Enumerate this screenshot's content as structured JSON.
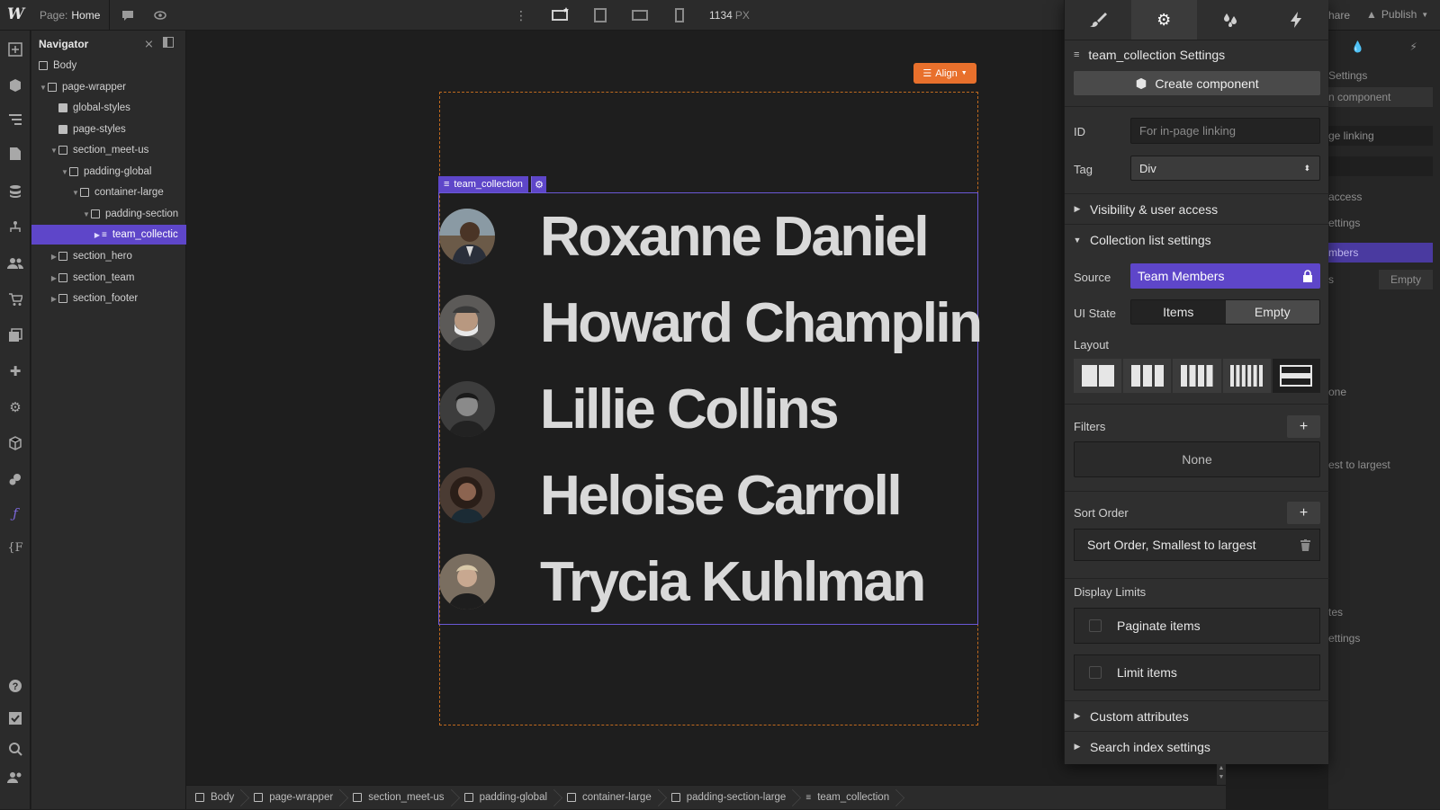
{
  "topbar": {
    "logo": "W",
    "page_prefix": "Page:",
    "page_name": "Home",
    "width_value": "1134",
    "width_unit": "PX",
    "share_label": "hare",
    "publish_label": "Publish"
  },
  "navigator": {
    "title": "Navigator",
    "items": [
      {
        "label": "Body"
      },
      {
        "label": "page-wrapper"
      },
      {
        "label": "global-styles"
      },
      {
        "label": "page-styles"
      },
      {
        "label": "section_meet-us"
      },
      {
        "label": "padding-global"
      },
      {
        "label": "container-large"
      },
      {
        "label": "padding-section"
      },
      {
        "label": "team_collectic"
      },
      {
        "label": "section_hero"
      },
      {
        "label": "section_team"
      },
      {
        "label": "section_footer"
      }
    ]
  },
  "canvas": {
    "align_label": "Align",
    "collection_tag": "team_collection",
    "members": [
      {
        "name": "Roxanne Daniel",
        "avatar_color": "#6b5a48"
      },
      {
        "name": "Howard Champlin",
        "avatar_color": "#5c5a58"
      },
      {
        "name": "Lillie Collins",
        "avatar_color": "#3d3d3d"
      },
      {
        "name": "Heloise Carroll",
        "avatar_color": "#4a3b33"
      },
      {
        "name": "Trycia Kuhlman",
        "avatar_color": "#7a6e60"
      }
    ]
  },
  "panel": {
    "header_title": "team_collection Settings",
    "create_component_label": "Create component",
    "id_label": "ID",
    "id_placeholder": "For in-page linking",
    "tag_label": "Tag",
    "tag_value": "Div",
    "visibility_label": "Visibility & user access",
    "collection_settings_label": "Collection list settings",
    "source_label": "Source",
    "source_value": "Team Members",
    "ui_state_label": "UI State",
    "ui_state_items": "Items",
    "ui_state_empty": "Empty",
    "layout_label": "Layout",
    "filters_label": "Filters",
    "filters_value": "None",
    "sort_order_label": "Sort Order",
    "sort_order_value": "Sort Order, Smallest to largest",
    "display_limits_label": "Display Limits",
    "paginate_label": "Paginate items",
    "limit_label": "Limit items",
    "custom_attributes_label": "Custom attributes",
    "search_index_label": "Search index settings",
    "accent_color": "#5e46c9"
  },
  "ghost_panel": {
    "settings": "Settings",
    "component": "n component",
    "linking": "ge linking",
    "access": "access",
    "ettings": "ettings",
    "members": "mbers",
    "s": "s",
    "empty": "Empty",
    "one": "one",
    "largest": "est to largest",
    "tes": "tes",
    "ettings2": "ettings"
  },
  "breadcrumb": [
    {
      "label": "Body"
    },
    {
      "label": "page-wrapper"
    },
    {
      "label": "section_meet-us"
    },
    {
      "label": "padding-global"
    },
    {
      "label": "container-large"
    },
    {
      "label": "padding-section-large"
    },
    {
      "label": "team_collection"
    }
  ]
}
